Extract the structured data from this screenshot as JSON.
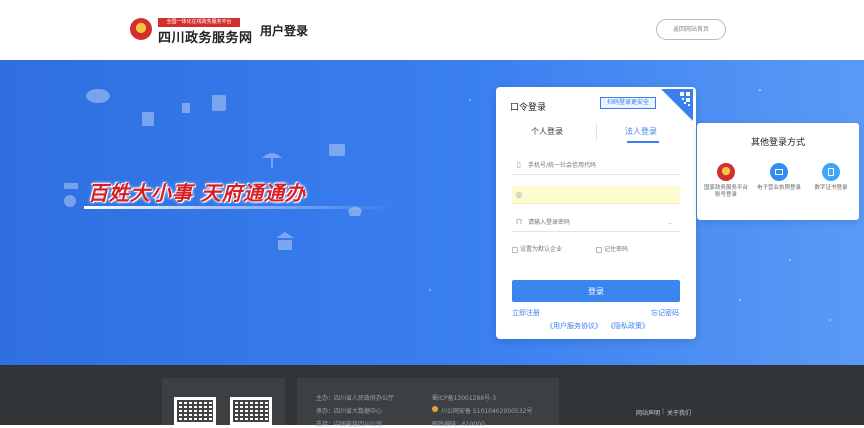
{
  "header": {
    "logo_badge": "全国一体化在线政务服务平台",
    "logo_text": "四川政务服务网",
    "page_title": "用户登录",
    "home_button": "返回网站首页"
  },
  "banner": {
    "slogan": "百姓大小事 天府通通办"
  },
  "login": {
    "title": "口令登录",
    "qr_tag": "扫码登录更安全",
    "tabs": [
      {
        "label": "个人登录",
        "active": false
      },
      {
        "label": "法人登录",
        "active": true
      }
    ],
    "account_placeholder": "手机号/统一社会信用代码",
    "password_placeholder": "请输入登录密码",
    "checkbox_default_enterprise": "设置为默认企业",
    "checkbox_remember": "记住密码",
    "login_button": "登录",
    "register_link": "立即注册",
    "forgot_link": "忘记密码",
    "agreement_link": "《用户服务协议》",
    "privacy_link": "《隐私政策》"
  },
  "other_login": {
    "title": "其他登录方式",
    "items": [
      {
        "label": "国家政务服务平台账号登录",
        "icon": "national-emblem-icon"
      },
      {
        "label": "电子营业执照登录",
        "icon": "business-license-icon"
      },
      {
        "label": "数字证书登录",
        "icon": "digital-certificate-icon"
      }
    ]
  },
  "footer": {
    "sponsor": "主办：四川省人民政府办公厅",
    "organizer": "承办：四川省大数据中心",
    "support": "支持：中国电信四川公司",
    "icp": "蜀ICP备13001288号-3",
    "police": "川公网安备 51010402000532号",
    "zipcode": "邮政编码：610000",
    "site_statement": "网站声明",
    "about_us": "关于我们"
  },
  "colors": {
    "primary": "#3a86f0",
    "banner": "#3a7ff0",
    "slogan": "#d61f26",
    "footer": "#323538"
  }
}
